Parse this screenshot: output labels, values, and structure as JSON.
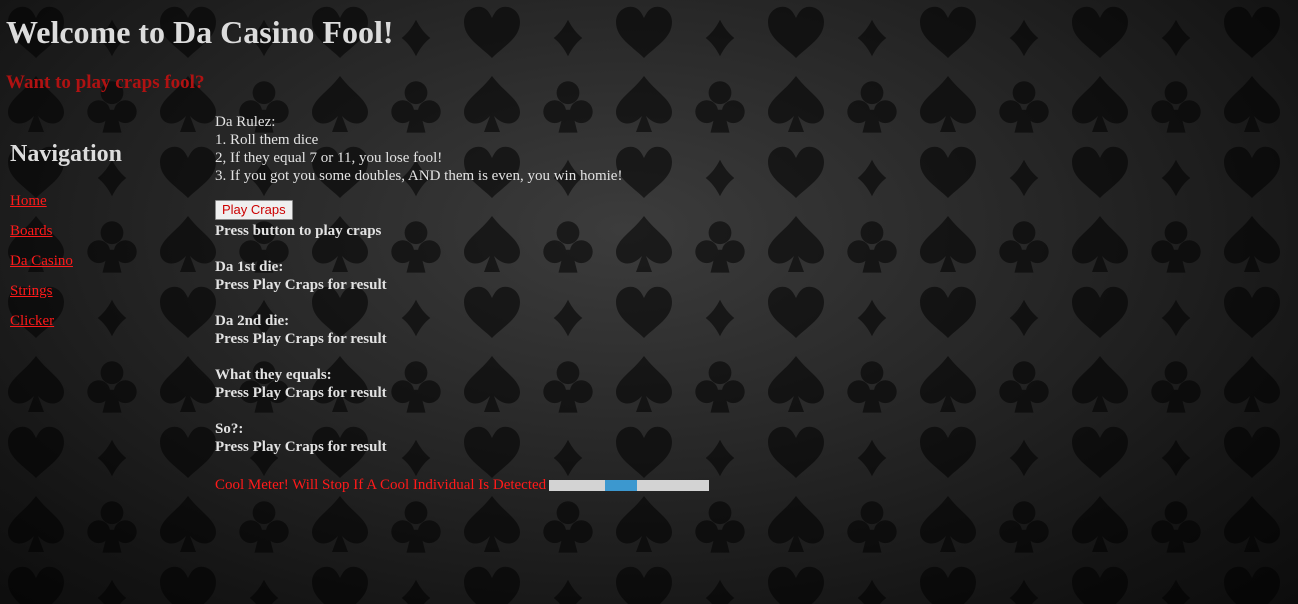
{
  "header": {
    "title": "Welcome to Da Casino Fool!",
    "subtitle": "Want to play craps fool?"
  },
  "nav": {
    "heading": "Navigation",
    "items": [
      {
        "label": "Home"
      },
      {
        "label": "Boards"
      },
      {
        "label": "Da Casino"
      },
      {
        "label": "Strings"
      },
      {
        "label": "Clicker"
      }
    ]
  },
  "rules": {
    "heading": "Da Rulez:",
    "lines": [
      "1. Roll them dice",
      "2, If they equal 7 or 11, you lose fool!",
      "3. If you got you some doubles, AND them is even, you win homie!"
    ]
  },
  "game": {
    "button_label": "Play Craps",
    "status": "Press button to play craps",
    "results": [
      {
        "label": "Da 1st die:",
        "value": "Press Play Craps for result"
      },
      {
        "label": "Da 2nd die:",
        "value": "Press Play Craps for result"
      },
      {
        "label": "What they equals:",
        "value": "Press Play Craps for result"
      },
      {
        "label": "So?:",
        "value": "Press Play Craps for result"
      }
    ]
  },
  "meter": {
    "label": "Cool Meter! Will Stop If A Cool Individual Is Detected",
    "segment_start": 0.35,
    "segment_end": 0.55
  },
  "colors": {
    "link": "#ff1a1a",
    "subtitle": "#b01212",
    "meter_fill": "#3c98cf",
    "meter_track": "#d3d3d3"
  }
}
